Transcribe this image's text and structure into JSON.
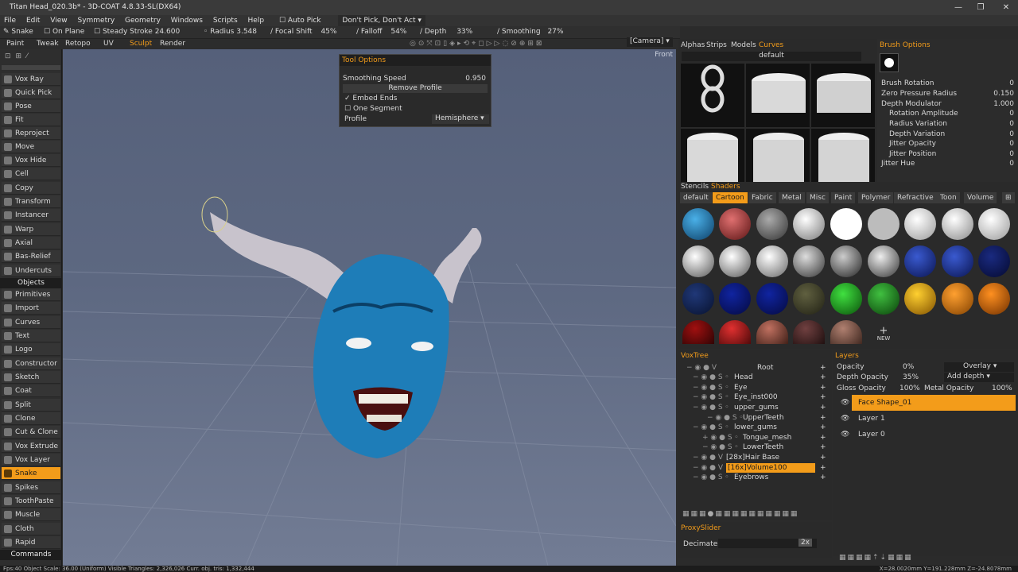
{
  "title": "Titan Head_020.3b* - 3D-COAT 4.8.33-SL(DX64)",
  "menu": [
    "File",
    "Edit",
    "View",
    "Symmetry",
    "Geometry",
    "Windows",
    "Scripts",
    "Help"
  ],
  "auto_pick": "Auto Pick",
  "pick_mode": "Don't Pick, Don't Act",
  "toolbar": {
    "tool": "Snake",
    "on_plane": "On Plane",
    "steady_stroke": "Steady Stroke",
    "steady_stroke_val": "24.600",
    "radius": "Radius",
    "radius_val": "3.548",
    "focal_shift": "Focal Shift",
    "focal_shift_val": "45%",
    "falloff": "Falloff",
    "falloff_val": "54%",
    "depth": "Depth",
    "depth_val": "33%",
    "smoothing": "Smoothing",
    "smoothing_val": "27%",
    "camera": "[Camera]"
  },
  "rooms": [
    "Paint",
    "Tweak",
    "Retopo",
    "UV",
    "Sculpt",
    "Render"
  ],
  "active_room": "Sculpt",
  "tools": [
    "Vox Ray",
    "Quick Pick",
    "Pose",
    "Fit",
    "Reproject",
    "Move",
    "Vox Hide",
    "Cell",
    "Copy",
    "Transform",
    "Instancer",
    "Warp",
    "Axial",
    "Bas-Relief",
    "Undercuts"
  ],
  "objects_label": "Objects",
  "objects": [
    "Primitives",
    "Import",
    "Curves",
    "Text",
    "Logo",
    "Constructor",
    "Sketch",
    "Coat",
    "Split",
    "Clone",
    "Cut & Clone",
    "Vox Extrude",
    "Vox Layer",
    "Snake",
    "Spikes",
    "ToothPaste",
    "Muscle",
    "Cloth",
    "Rapid"
  ],
  "commands_label": "Commands",
  "viewport": {
    "view_label": "Front"
  },
  "tool_options": {
    "title": "Tool Options",
    "smoothing_speed": "Smoothing Speed",
    "smoothing_speed_val": "0.950",
    "remove_profile": "Remove Profile",
    "embed_ends": "Embed Ends",
    "one_segment": "One Segment",
    "profile": "Profile",
    "profile_val": "Hemisphere"
  },
  "panel_tabs": [
    "Alphas",
    "Strips",
    "Models",
    "Curves"
  ],
  "active_panel_tab": "Curves",
  "alpha_preset": "default",
  "brush_options": {
    "title": "Brush Options",
    "rows": [
      {
        "label": "Brush Rotation",
        "value": "0"
      },
      {
        "label": "Zero Pressure Radius",
        "value": "0.150"
      },
      {
        "label": "Depth Modulator",
        "value": "1.000"
      },
      {
        "label": "Rotation Amplitude",
        "value": "0"
      },
      {
        "label": "Radius Variation",
        "value": "0"
      },
      {
        "label": "Depth Variation",
        "value": "0"
      },
      {
        "label": "Jitter Opacity",
        "value": "0"
      },
      {
        "label": "Jitter Position",
        "value": "0"
      },
      {
        "label": "Jitter Hue",
        "value": "0"
      }
    ]
  },
  "stencils_tabs": [
    "Stencils",
    "Shaders"
  ],
  "shader_tabs": [
    "default",
    "Cartoon",
    "Fabric",
    "Metal",
    "Misc",
    "Paint",
    "Polymer",
    "Refractive",
    "Toon",
    "Volume"
  ],
  "active_shader_tab": "Cartoon",
  "new_label": "NEW",
  "voxtree": {
    "title": "VoxTree",
    "root": "Root",
    "items": [
      "Head",
      "Eye",
      "Eye_inst000",
      "upper_gums",
      "UpperTeeth",
      "lower_gums",
      "Tongue_mesh",
      "LowerTeeth",
      "[28x]Hair Base",
      "[16x]Volume100",
      "Eyebrows"
    ]
  },
  "layers": {
    "title": "Layers",
    "opacity": "Opacity",
    "opacity_val": "0%",
    "blend": "Overlay",
    "depth_opacity": "Depth Opacity",
    "depth_opacity_val": "35%",
    "add_depth": "Add depth",
    "gloss_opacity": "Gloss Opacity",
    "gloss_opacity_val": "100%",
    "metal_opacity": "Metal Opacity",
    "metal_opacity_val": "100%",
    "items": [
      "Face Shape_01",
      "Layer 1",
      "Layer 0"
    ]
  },
  "proxy": {
    "title": "ProxySlider",
    "decimate": "Decimate",
    "level": "2x"
  },
  "status": "Fps:40   Object Scale: 36.00 (Uniform)   Visible Triangles: 2,326,026   Curr. obj. tris: 1,332,444",
  "coords": "X=28.0020mm  Y=191.228mm  Z=-24.8078mm",
  "colors": {
    "accent": "#f39c1a",
    "head": "#1e7db8"
  }
}
